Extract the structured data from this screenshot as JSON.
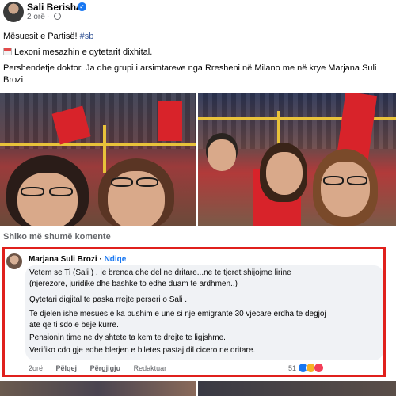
{
  "post": {
    "author": "Sali Berisha",
    "time": "2 orë",
    "line1_text": "Mësuesit e Partisë! ",
    "line1_hashtag": "#sb",
    "line2": "Lexoni mesazhin e qytetarit dixhital.",
    "line3": "Pershendetje doktor. Ja dhe grupi i arsimtareve nga Rresheni në Milano me në krye Marjana Suli",
    "line4": "Brozi"
  },
  "more_comments": "Shiko më shumë komente",
  "comment": {
    "author": "Marjana Suli Brozi",
    "separator": " · ",
    "follow": "Ndiqe",
    "lines": [
      "Vetem se Ti (Sali ) , je brenda dhe del ne dritare...ne te tjeret shijojme lirine",
      "(njerezore, juridike dhe bashke to edhe duam te ardhmen..)",
      "Qytetari digjital te paska rrejte perseri o Sali .",
      "Te djelen ishe mesues e ka pushim e une si nje emigrante 30 vjecare erdha te degjoj",
      "ate qe ti sdo e beje kurre.",
      "Pensionin time ne dy shtete ta kem te drejte te ligjshme.",
      "Verifiko cdo gje edhe blerjen e biletes pastaj dil cicero ne dritare."
    ],
    "time": "2orë",
    "like": "Pëlqej",
    "reply": "Përgjigju",
    "edited": "Redaktuar",
    "reaction_count": "51",
    "highlight_color": "#e0201c"
  },
  "colors": {
    "link": "#1877f2",
    "hashtag": "#385898",
    "secondary_text": "#65676b",
    "bubble": "#f0f2f5"
  }
}
